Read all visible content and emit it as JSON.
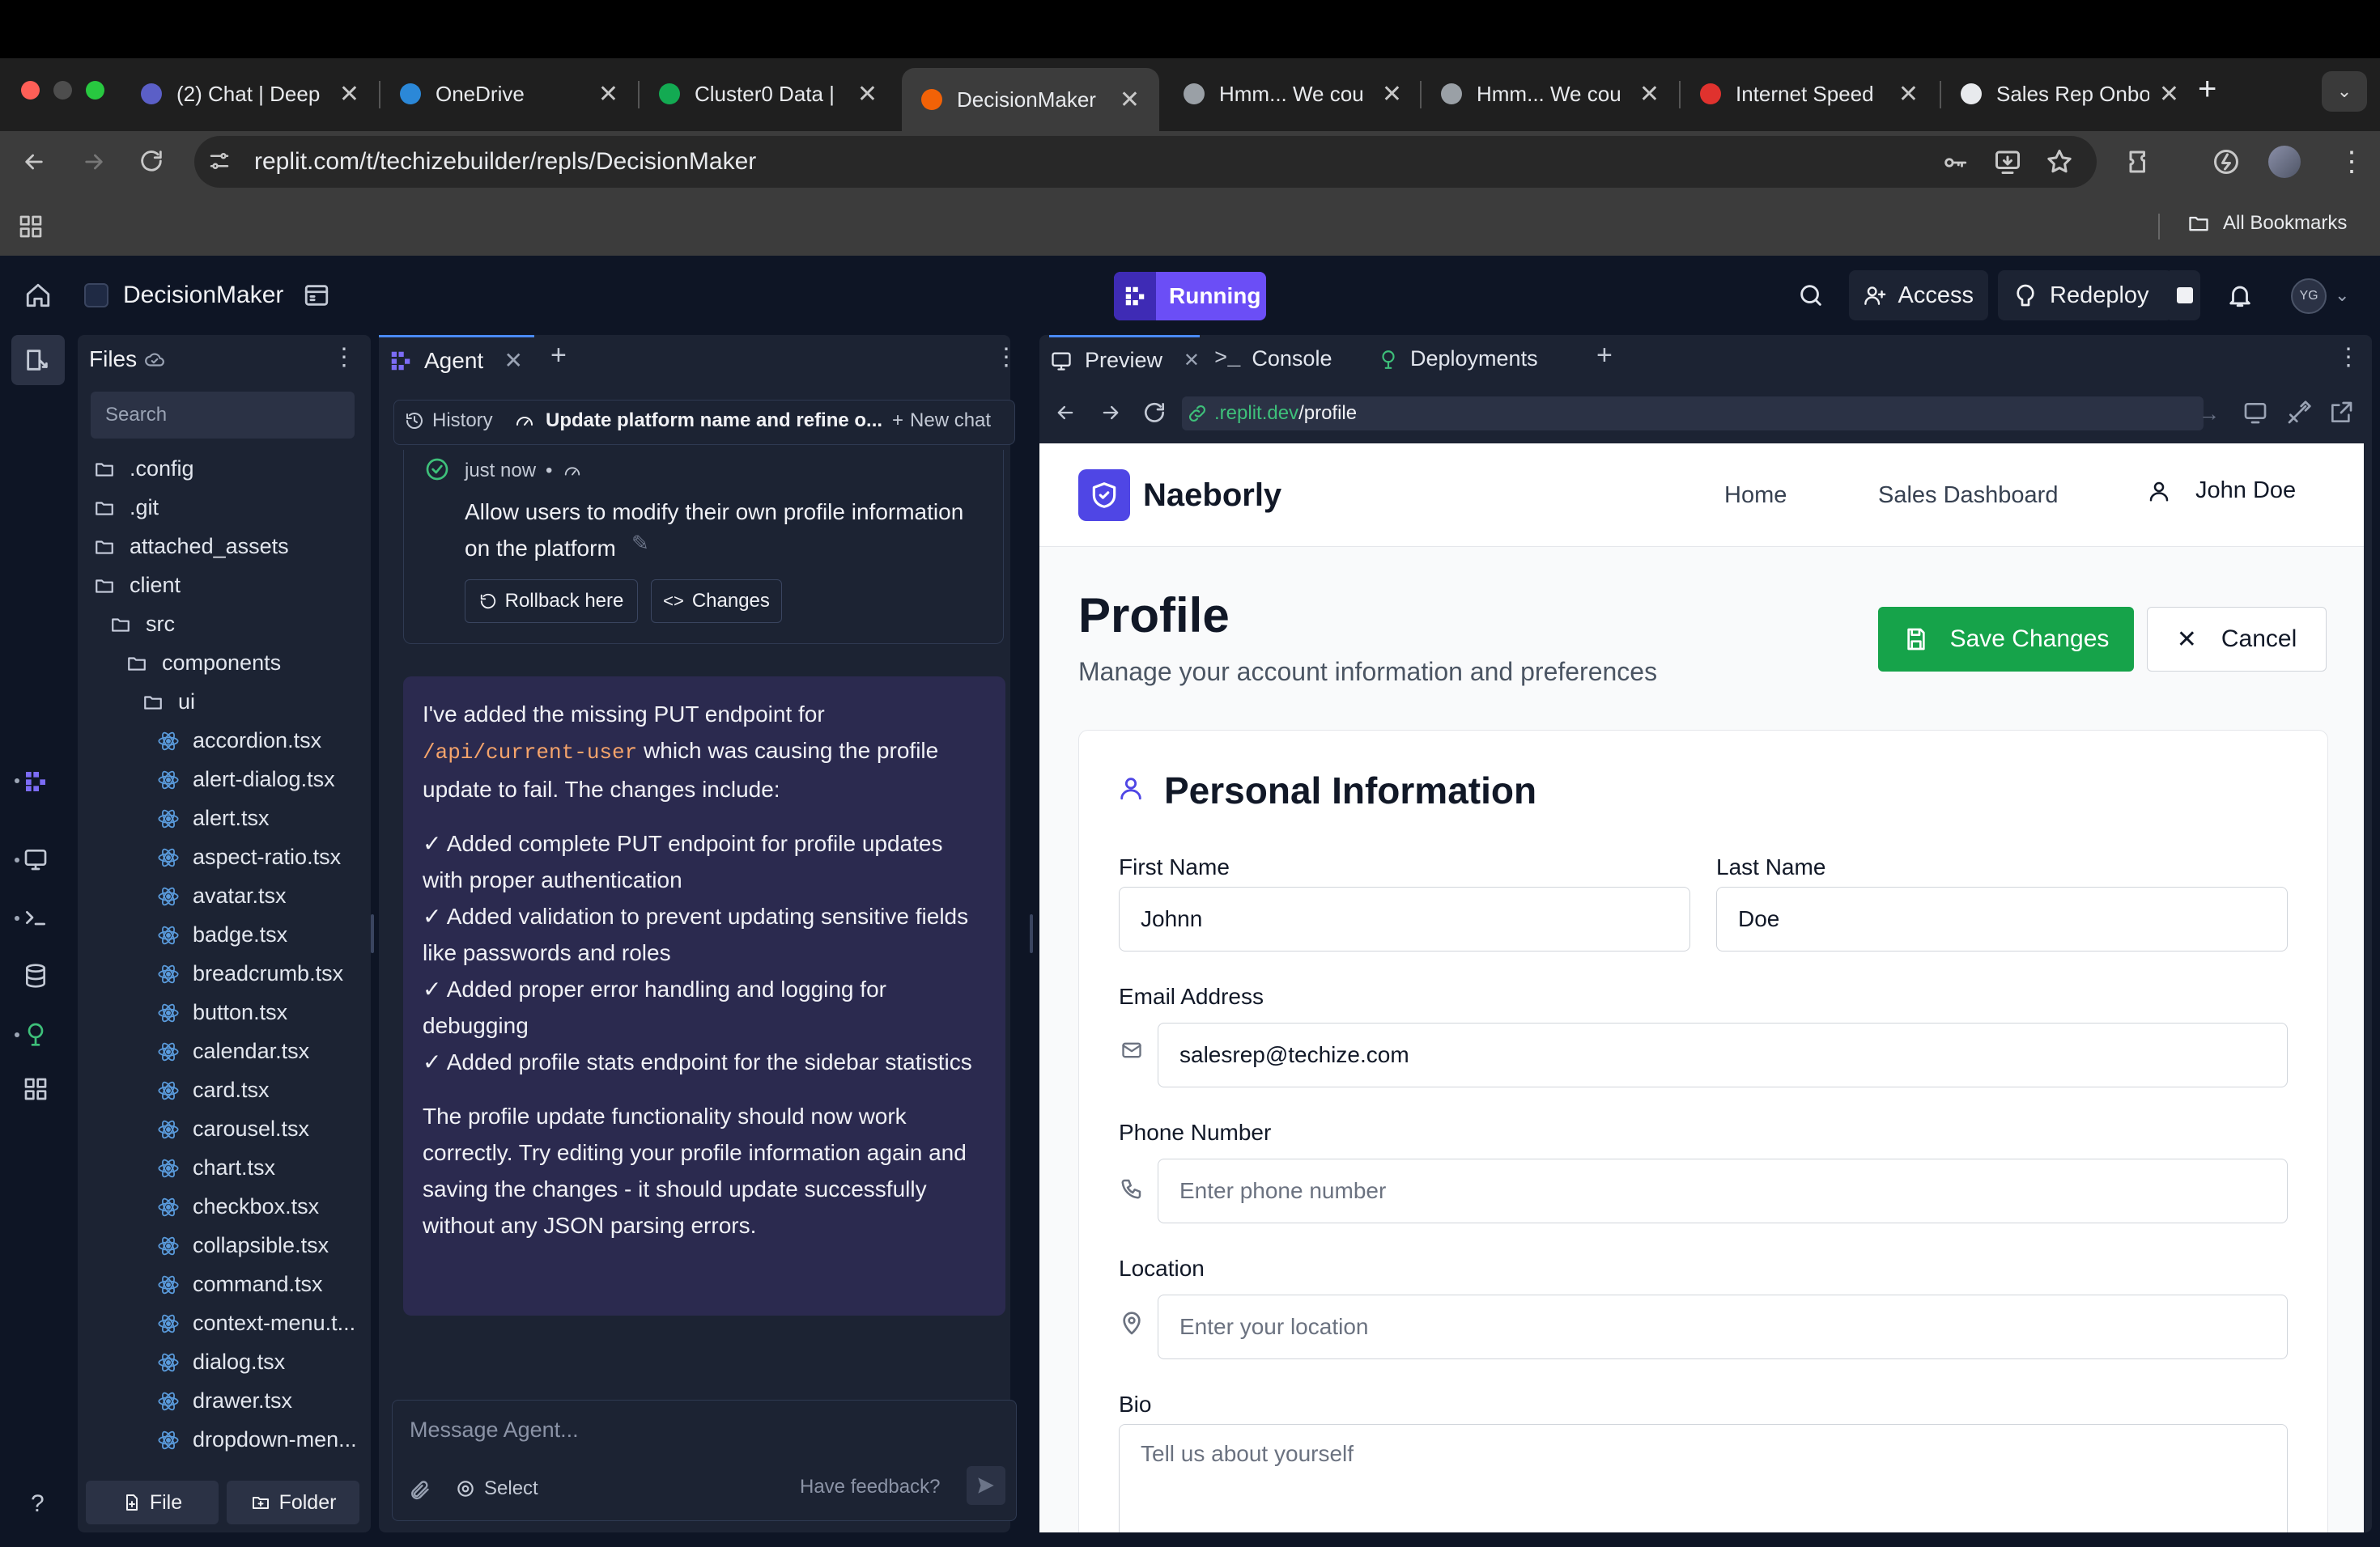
{
  "browser": {
    "tabs": [
      {
        "title": "(2) Chat | Deep",
        "color": "#5b5fc7"
      },
      {
        "title": "OneDrive",
        "color": "#2b88d8"
      },
      {
        "title": "Cluster0 Data |",
        "color": "#13aa52"
      },
      {
        "title": "DecisionMaker",
        "color": "#f26207",
        "active": true
      },
      {
        "title": "Hmm... We cou",
        "color": "#9aa0a6"
      },
      {
        "title": "Hmm... We cou",
        "color": "#9aa0a6"
      },
      {
        "title": "Internet Speed",
        "color": "#e0322e"
      },
      {
        "title": "Sales Rep Onbo",
        "color": "#e8eaed"
      }
    ],
    "url": "replit.com/t/techizebuilder/repls/DecisionMaker",
    "bookmarks_label": "All Bookmarks"
  },
  "replit": {
    "project_name": "DecisionMaker",
    "status": "Running",
    "access_label": "Access",
    "redeploy_label": "Redeploy",
    "avatar_initials": "YG"
  },
  "files": {
    "title": "Files",
    "search_placeholder": "Search",
    "items": [
      {
        "name": ".config",
        "type": "folder",
        "depth": 0
      },
      {
        "name": ".git",
        "type": "folder",
        "depth": 0
      },
      {
        "name": "attached_assets",
        "type": "folder",
        "depth": 0
      },
      {
        "name": "client",
        "type": "folder",
        "depth": 0
      },
      {
        "name": "src",
        "type": "folder",
        "depth": 1
      },
      {
        "name": "components",
        "type": "folder",
        "depth": 2
      },
      {
        "name": "ui",
        "type": "folder",
        "depth": 3
      },
      {
        "name": "accordion.tsx",
        "type": "file",
        "depth": 4
      },
      {
        "name": "alert-dialog.tsx",
        "type": "file",
        "depth": 4
      },
      {
        "name": "alert.tsx",
        "type": "file",
        "depth": 4
      },
      {
        "name": "aspect-ratio.tsx",
        "type": "file",
        "depth": 4
      },
      {
        "name": "avatar.tsx",
        "type": "file",
        "depth": 4
      },
      {
        "name": "badge.tsx",
        "type": "file",
        "depth": 4
      },
      {
        "name": "breadcrumb.tsx",
        "type": "file",
        "depth": 4
      },
      {
        "name": "button.tsx",
        "type": "file",
        "depth": 4
      },
      {
        "name": "calendar.tsx",
        "type": "file",
        "depth": 4
      },
      {
        "name": "card.tsx",
        "type": "file",
        "depth": 4
      },
      {
        "name": "carousel.tsx",
        "type": "file",
        "depth": 4
      },
      {
        "name": "chart.tsx",
        "type": "file",
        "depth": 4
      },
      {
        "name": "checkbox.tsx",
        "type": "file",
        "depth": 4
      },
      {
        "name": "collapsible.tsx",
        "type": "file",
        "depth": 4
      },
      {
        "name": "command.tsx",
        "type": "file",
        "depth": 4
      },
      {
        "name": "context-menu.t...",
        "type": "file",
        "depth": 4
      },
      {
        "name": "dialog.tsx",
        "type": "file",
        "depth": 4
      },
      {
        "name": "drawer.tsx",
        "type": "file",
        "depth": 4
      },
      {
        "name": "dropdown-men...",
        "type": "file",
        "depth": 4
      }
    ],
    "new_file_label": "File",
    "new_folder_label": "Folder"
  },
  "agent": {
    "tab_label": "Agent",
    "history_label": "History",
    "chat_title": "Update platform name and refine o...",
    "new_chat_label": "New chat",
    "checkpoint_time": "just now",
    "checkpoint_text": "Allow users to modify their own profile information on the platform",
    "rollback_label": "Rollback here",
    "changes_label": "Changes",
    "message_intro_1": "I've added the missing PUT endpoint for",
    "message_code": "/api/current-user",
    "message_intro_2": "which was causing the profile update to fail. The changes include:",
    "bullets": [
      "✓ Added complete PUT endpoint for profile updates with proper authentication",
      "✓ Added validation to prevent updating sensitive fields like passwords and roles",
      "✓ Added proper error handling and logging for debugging",
      "✓ Added profile stats endpoint for the sidebar statistics"
    ],
    "message_outro": "The profile update functionality should now work correctly. Try editing your profile information again and saving the changes - it should update successfully without any JSON parsing errors.",
    "input_placeholder": "Message Agent...",
    "select_label": "Select",
    "feedback_label": "Have feedback?"
  },
  "preview": {
    "tabs": [
      "Preview",
      "Console",
      "Deployments"
    ],
    "url_domain": ".replit.dev",
    "url_path": "/profile"
  },
  "site": {
    "brand": "Naeborly",
    "nav": [
      "Home",
      "Sales Dashboard"
    ],
    "user_name": "John Doe",
    "page_title": "Profile",
    "page_subtitle": "Manage your account information and preferences",
    "save_label": "Save Changes",
    "cancel_label": "Cancel",
    "section_title": "Personal Information",
    "first_name_label": "First Name",
    "first_name_value": "Johnn",
    "last_name_label": "Last Name",
    "last_name_value": "Doe",
    "email_label": "Email Address",
    "email_value": "salesrep@techize.com",
    "phone_label": "Phone Number",
    "phone_placeholder": "Enter phone number",
    "location_label": "Location",
    "location_placeholder": "Enter your location",
    "bio_label": "Bio",
    "bio_placeholder": "Tell us about yourself",
    "accent": "#16a34a",
    "brand_color": "#4f46e5"
  }
}
